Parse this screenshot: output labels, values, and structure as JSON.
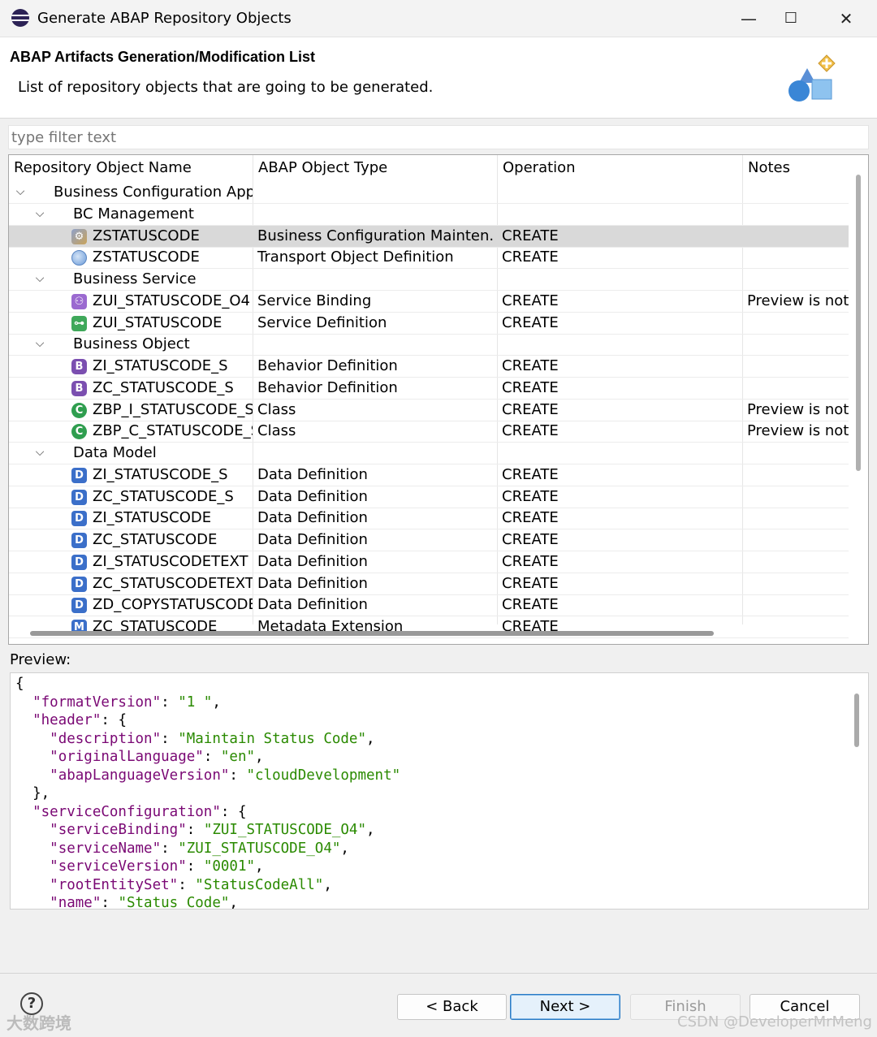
{
  "window": {
    "title": "Generate ABAP Repository Objects",
    "minimize": "—",
    "maximize": "☐",
    "close": "✕"
  },
  "header": {
    "heading": "ABAP Artifacts Generation/Modification List",
    "description": "List of repository objects that are going to be generated."
  },
  "filter": {
    "placeholder": "type filter text"
  },
  "tree": {
    "columns": [
      "Repository Object Name",
      "ABAP Object Type",
      "Operation",
      "Notes"
    ],
    "rows": [
      {
        "level": 0,
        "expander": "expanded",
        "name": "Business Configuration Appl",
        "type": "",
        "operation": "",
        "notes": ""
      },
      {
        "level": 1,
        "expander": "expanded",
        "name": "BC Management",
        "type": "",
        "operation": "",
        "notes": ""
      },
      {
        "level": 2,
        "icon": "bc-maintenance-object-icon",
        "name": "ZSTATUSCODE",
        "type": "Business Configuration Mainten...",
        "operation": "CREATE",
        "notes": "",
        "selected": true
      },
      {
        "level": 2,
        "icon": "transport-object-icon",
        "name": "ZSTATUSCODE",
        "type": "Transport Object Definition",
        "operation": "CREATE",
        "notes": ""
      },
      {
        "level": 1,
        "expander": "expanded",
        "name": "Business Service",
        "type": "",
        "operation": "",
        "notes": ""
      },
      {
        "level": 2,
        "icon": "service-binding-icon",
        "name": "ZUI_STATUSCODE_O4",
        "type": "Service Binding",
        "operation": "CREATE",
        "notes": "Preview is not"
      },
      {
        "level": 2,
        "icon": "service-definition-icon",
        "name": "ZUI_STATUSCODE",
        "type": "Service Definition",
        "operation": "CREATE",
        "notes": ""
      },
      {
        "level": 1,
        "expander": "expanded",
        "name": "Business Object",
        "type": "",
        "operation": "",
        "notes": ""
      },
      {
        "level": 2,
        "icon": "behavior-definition-icon",
        "name": "ZI_STATUSCODE_S",
        "type": "Behavior Definition",
        "operation": "CREATE",
        "notes": ""
      },
      {
        "level": 2,
        "icon": "behavior-definition-icon",
        "name": "ZC_STATUSCODE_S",
        "type": "Behavior Definition",
        "operation": "CREATE",
        "notes": ""
      },
      {
        "level": 2,
        "icon": "class-icon",
        "name": "ZBP_I_STATUSCODE_S",
        "type": "Class",
        "operation": "CREATE",
        "notes": "Preview is not"
      },
      {
        "level": 2,
        "icon": "class-icon",
        "name": "ZBP_C_STATUSCODE_S",
        "type": "Class",
        "operation": "CREATE",
        "notes": "Preview is not"
      },
      {
        "level": 1,
        "expander": "expanded",
        "name": "Data Model",
        "type": "",
        "operation": "",
        "notes": ""
      },
      {
        "level": 2,
        "icon": "data-definition-icon",
        "name": "ZI_STATUSCODE_S",
        "type": "Data Definition",
        "operation": "CREATE",
        "notes": ""
      },
      {
        "level": 2,
        "icon": "data-definition-icon",
        "name": "ZC_STATUSCODE_S",
        "type": "Data Definition",
        "operation": "CREATE",
        "notes": ""
      },
      {
        "level": 2,
        "icon": "data-definition-icon",
        "name": "ZI_STATUSCODE",
        "type": "Data Definition",
        "operation": "CREATE",
        "notes": ""
      },
      {
        "level": 2,
        "icon": "data-definition-icon",
        "name": "ZC_STATUSCODE",
        "type": "Data Definition",
        "operation": "CREATE",
        "notes": ""
      },
      {
        "level": 2,
        "icon": "data-definition-icon",
        "name": "ZI_STATUSCODETEXT",
        "type": "Data Definition",
        "operation": "CREATE",
        "notes": ""
      },
      {
        "level": 2,
        "icon": "data-definition-icon",
        "name": "ZC_STATUSCODETEXT",
        "type": "Data Definition",
        "operation": "CREATE",
        "notes": ""
      },
      {
        "level": 2,
        "icon": "data-definition-icon",
        "name": "ZD_COPYSTATUSCODE",
        "type": "Data Definition",
        "operation": "CREATE",
        "notes": ""
      },
      {
        "level": 2,
        "icon": "metadata-extension-icon",
        "name": "ZC_STATUSCODE",
        "type": "Metadata Extension",
        "operation": "CREATE",
        "notes": ""
      }
    ]
  },
  "preview": {
    "label": "Preview:",
    "lines": [
      [
        [
          "p",
          "{"
        ]
      ],
      [
        [
          "p",
          "  "
        ],
        [
          "k",
          "\"formatVersion\""
        ],
        [
          "p",
          ": "
        ],
        [
          "s",
          "\"1 \""
        ],
        [
          "p",
          ","
        ]
      ],
      [
        [
          "p",
          "  "
        ],
        [
          "k",
          "\"header\""
        ],
        [
          "p",
          ": {"
        ]
      ],
      [
        [
          "p",
          "    "
        ],
        [
          "k",
          "\"description\""
        ],
        [
          "p",
          ": "
        ],
        [
          "s",
          "\"Maintain Status Code\""
        ],
        [
          "p",
          ","
        ]
      ],
      [
        [
          "p",
          "    "
        ],
        [
          "k",
          "\"originalLanguage\""
        ],
        [
          "p",
          ": "
        ],
        [
          "s",
          "\"en\""
        ],
        [
          "p",
          ","
        ]
      ],
      [
        [
          "p",
          "    "
        ],
        [
          "k",
          "\"abapLanguageVersion\""
        ],
        [
          "p",
          ": "
        ],
        [
          "s",
          "\"cloudDevelopment\""
        ]
      ],
      [
        [
          "p",
          "  },"
        ]
      ],
      [
        [
          "p",
          "  "
        ],
        [
          "k",
          "\"serviceConfiguration\""
        ],
        [
          "p",
          ": {"
        ]
      ],
      [
        [
          "p",
          "    "
        ],
        [
          "k",
          "\"serviceBinding\""
        ],
        [
          "p",
          ": "
        ],
        [
          "s",
          "\"ZUI_STATUSCODE_O4\""
        ],
        [
          "p",
          ","
        ]
      ],
      [
        [
          "p",
          "    "
        ],
        [
          "k",
          "\"serviceName\""
        ],
        [
          "p",
          ": "
        ],
        [
          "s",
          "\"ZUI_STATUSCODE_O4\""
        ],
        [
          "p",
          ","
        ]
      ],
      [
        [
          "p",
          "    "
        ],
        [
          "k",
          "\"serviceVersion\""
        ],
        [
          "p",
          ": "
        ],
        [
          "s",
          "\"0001\""
        ],
        [
          "p",
          ","
        ]
      ],
      [
        [
          "p",
          "    "
        ],
        [
          "k",
          "\"rootEntitySet\""
        ],
        [
          "p",
          ": "
        ],
        [
          "s",
          "\"StatusCodeAll\""
        ],
        [
          "p",
          ","
        ]
      ],
      [
        [
          "p",
          "    "
        ],
        [
          "k",
          "\"name\""
        ],
        [
          "p",
          ": "
        ],
        [
          "s",
          "\"Status Code\""
        ],
        [
          "p",
          ","
        ]
      ]
    ]
  },
  "buttons": {
    "help": "?",
    "back": "< Back",
    "next": "Next >",
    "finish": "Finish",
    "cancel": "Cancel"
  },
  "watermarks": {
    "left": "大数跨境",
    "right": "CSDN @DeveloperMrMeng"
  },
  "colors": {
    "selection": "#d9d9d9",
    "json_key": "#7a0874",
    "json_string": "#2a8a00",
    "next_button_border": "#2a7cc6"
  }
}
